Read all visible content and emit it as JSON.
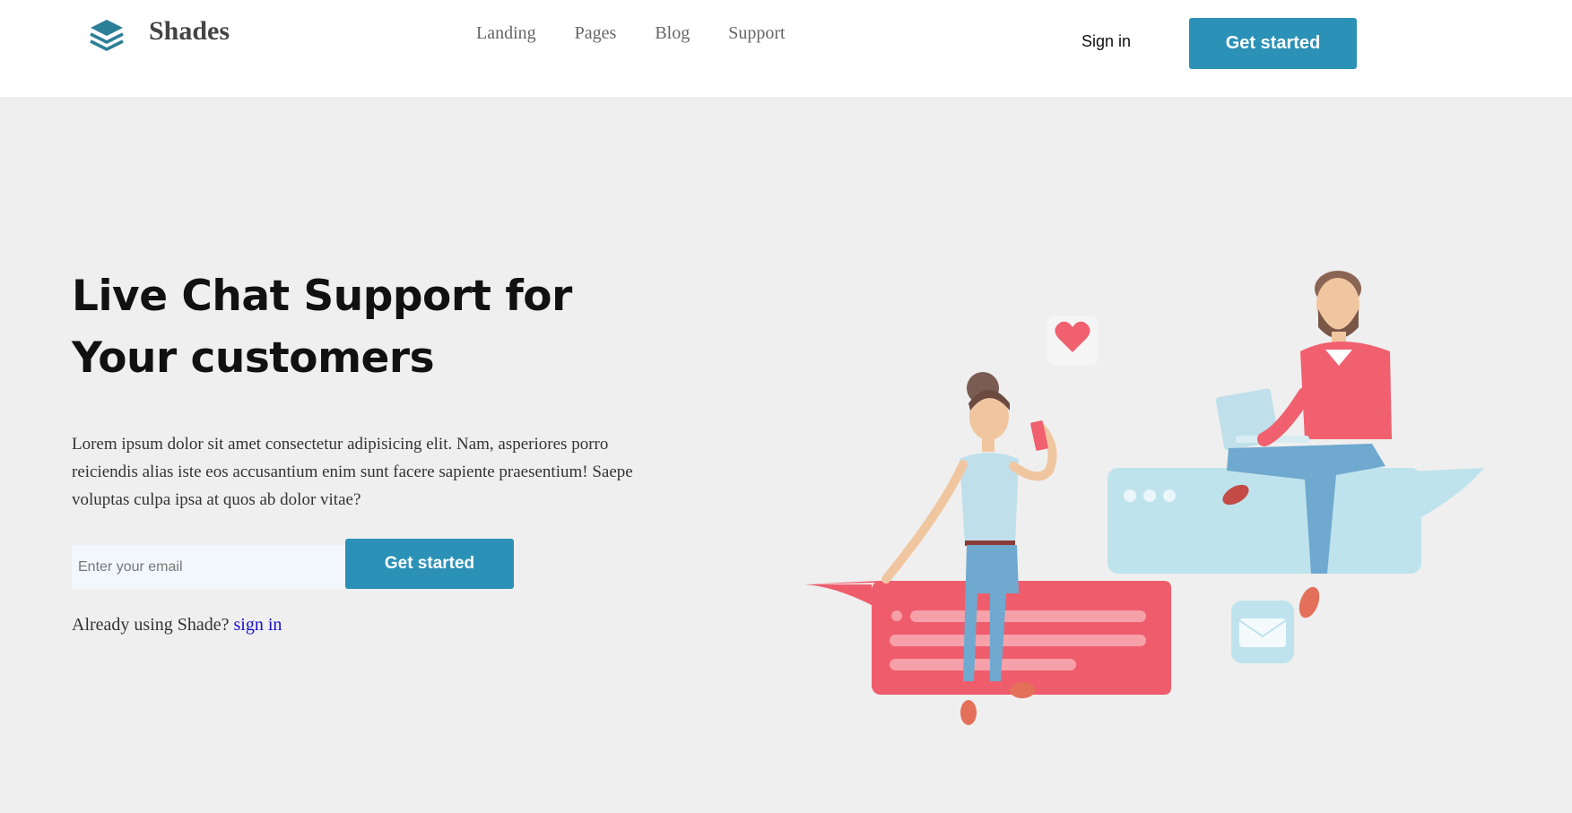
{
  "brand": {
    "name": "Shades",
    "logo_icon": "stacked-layers-icon",
    "accent_color": "#2b91b6"
  },
  "nav": {
    "items": [
      "Landing",
      "Pages",
      "Blog",
      "Support"
    ]
  },
  "header": {
    "signin_label": "Sign in",
    "cta_label": "Get started"
  },
  "hero": {
    "title_line1": "Live Chat Support for",
    "title_line2": "Your customers",
    "description": "Lorem ipsum dolor sit amet consectetur adipisicing elit. Nam, asperiores porro reiciendis alias iste eos accusantium enim sunt facere sapiente praesentium! Saepe voluptas culpa ipsa at quos ab dolor vitae?",
    "email_placeholder": "Enter your email",
    "cta_label": "Get started",
    "already_text": "Already using Shade?",
    "signin_link": "sign in"
  },
  "illustration": {
    "icon": "live-chat-people-illustration",
    "colors": {
      "red": "#f0606f",
      "blue": "#bfe3ec"
    }
  }
}
